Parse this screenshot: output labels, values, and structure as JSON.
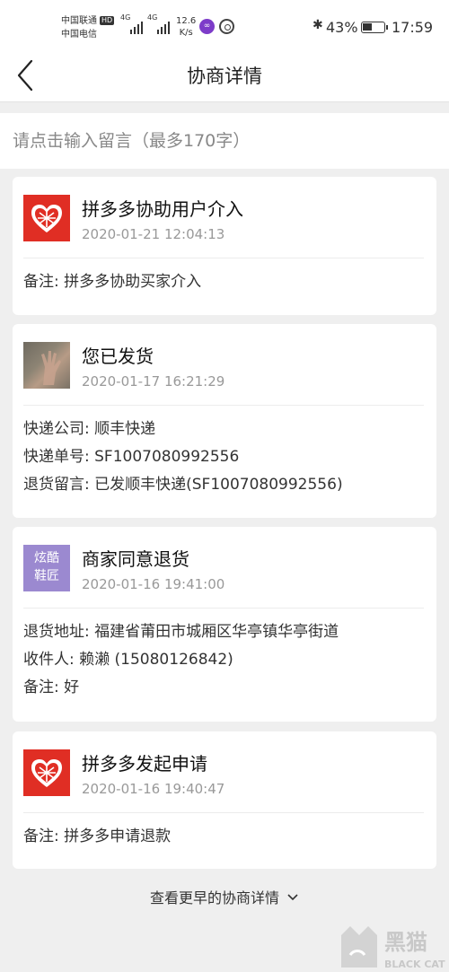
{
  "status_bar": {
    "carrier1": "中国联通",
    "carrier2": "中国电信",
    "hd_badge": "HD",
    "signal1_label": "4G",
    "signal2_label": "4G",
    "speed_value": "12.6",
    "speed_unit": "K/s",
    "battery_percent": "43%",
    "time": "17:59"
  },
  "nav": {
    "title": "协商详情"
  },
  "message_input": {
    "placeholder": "请点击输入留言（最多170字）"
  },
  "records": [
    {
      "avatar": "pinduoduo-logo",
      "title": "拼多多协助用户介入",
      "time": "2020-01-21 12:04:13",
      "lines": [
        "备注: 拼多多协助买家介入"
      ]
    },
    {
      "avatar": "buyer-photo",
      "title": "您已发货",
      "time": "2020-01-17 16:21:29",
      "lines": [
        "快递公司: 顺丰快递",
        "快递单号: SF1007080992556",
        "退货留言: 已发顺丰快递(SF1007080992556)"
      ]
    },
    {
      "avatar": "merchant-logo",
      "avatar_text_line1": "炫酷",
      "avatar_text_line2": "鞋匠",
      "title": "商家同意退货",
      "time": "2020-01-16 19:41:00",
      "lines": [
        "退货地址: 福建省莆田市城厢区华亭镇华亭街道",
        "收件人: 赖濑 (15080126842)",
        "备注: 好"
      ]
    },
    {
      "avatar": "pinduoduo-logo",
      "title": "拼多多发起申请",
      "time": "2020-01-16 19:40:47",
      "lines": [
        "备注: 拼多多申请退款"
      ]
    }
  ],
  "footer": {
    "more_label": "查看更早的协商详情",
    "watermark_cn": "黑猫",
    "watermark_en": "BLACK CAT"
  },
  "colors": {
    "pinduoduo_red": "#e02e24",
    "merchant_purple": "#9b89d0",
    "page_bg": "#efefef"
  }
}
